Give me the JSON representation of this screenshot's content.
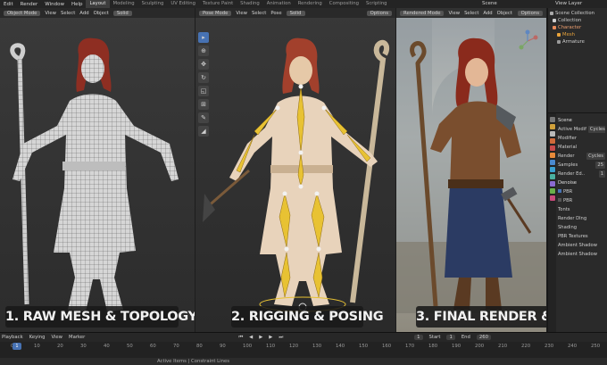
{
  "topbar": {
    "menus": [
      "Edit",
      "Render",
      "Window",
      "Help"
    ],
    "workspaces": [
      "Layout",
      "Modeling",
      "Sculpting",
      "UV Editing",
      "Texture Paint",
      "Shading",
      "Animation",
      "Rendering",
      "Compositing",
      "Scripting"
    ],
    "active_workspace": "Layout",
    "scene": "Scene",
    "view_layer": "View Layer"
  },
  "viewport1": {
    "mode": "Object Mode",
    "menus": [
      "View",
      "Select",
      "Add",
      "Object"
    ],
    "shading": "Solid",
    "caption": "1. RAW MESH & TOPOLOGY"
  },
  "viewport2": {
    "mode": "Pose Mode",
    "menus": [
      "View",
      "Select",
      "Pose"
    ],
    "shading": "Solid",
    "options": "Options",
    "caption": "2. RIGGING & POSING"
  },
  "viewport3": {
    "mode": "Rendered Mode",
    "menus": [
      "View",
      "Select",
      "Add",
      "Object"
    ],
    "options": "Options",
    "caption": "3. FINAL RENDER & SHADING"
  },
  "outliner": {
    "items": [
      {
        "label": "Scene Collection",
        "color": "#aaaaaa"
      },
      {
        "label": "Collection",
        "color": "#d0d0d0"
      },
      {
        "label": "Character",
        "color": "#e88a5a"
      },
      {
        "label": "Mesh",
        "color": "#e8a33b"
      },
      {
        "label": "Armature",
        "color": "#9a9a9a"
      }
    ]
  },
  "properties": {
    "rows": [
      {
        "label": "Scene",
        "value": ""
      },
      {
        "label": "Active Modif",
        "value": "Cycles"
      },
      {
        "label": "Modifier",
        "value": ""
      },
      {
        "label": "Material",
        "value": ""
      },
      {
        "label": "Render",
        "value": "Cycles"
      },
      {
        "label": "Samples",
        "value": "25"
      },
      {
        "label": "Render Ed..",
        "value": "1"
      },
      {
        "label": "Denoise",
        "value": ""
      },
      {
        "label": "PBR",
        "value": ""
      },
      {
        "label": "PBR",
        "value": ""
      },
      {
        "label": "Tonts",
        "value": ""
      },
      {
        "label": "Render Dlng",
        "value": ""
      },
      {
        "label": "Shading",
        "value": ""
      },
      {
        "label": "PBR Textures",
        "value": ""
      },
      {
        "label": "Ambient Shadow",
        "value": ""
      },
      {
        "label": "Ambient Shadow",
        "value": ""
      }
    ]
  },
  "timeline": {
    "menus": [
      "Playback",
      "Keying",
      "View",
      "Marker"
    ],
    "current_frame": "1",
    "start_label": "Start",
    "start": "1",
    "end_label": "End",
    "end": "260",
    "ticks": [
      "0",
      "10",
      "20",
      "30",
      "40",
      "50",
      "60",
      "70",
      "80",
      "90",
      "100",
      "110",
      "120",
      "130",
      "140",
      "150",
      "160",
      "170",
      "180",
      "190",
      "200",
      "210",
      "220",
      "230",
      "240",
      "250"
    ],
    "status": "Active Items | Constraint Lines"
  }
}
